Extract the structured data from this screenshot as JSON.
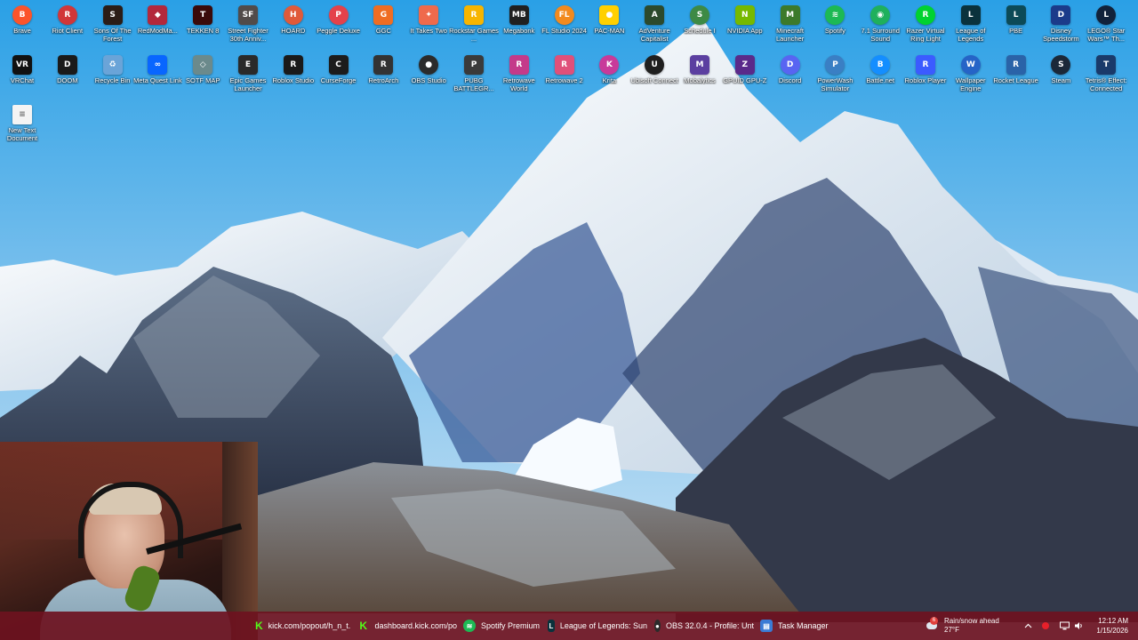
{
  "desktop": {
    "icons": [
      {
        "label": "Brave",
        "icon": "brave-icon",
        "color": "#fb542b",
        "glyph": "B",
        "round": true
      },
      {
        "label": "Riot Client",
        "icon": "riot-icon",
        "color": "#d13639",
        "glyph": "R",
        "round": true
      },
      {
        "label": "Sons Of The Forest",
        "icon": "sons-forest-icon",
        "color": "#2b1d17",
        "glyph": "S",
        "round": false
      },
      {
        "label": "RedModMa...",
        "icon": "redmod-icon",
        "color": "#b3283c",
        "glyph": "◆",
        "round": false
      },
      {
        "label": "TEKKEN 8",
        "icon": "tekken-icon",
        "color": "#3a0a0a",
        "glyph": "T",
        "round": false
      },
      {
        "label": "Street Fighter 30th Anniv...",
        "icon": "street-fighter-icon",
        "color": "#514b4a",
        "glyph": "SF",
        "round": false
      },
      {
        "label": "HOARD",
        "icon": "hoard-icon",
        "color": "#e05a3a",
        "glyph": "H",
        "round": true
      },
      {
        "label": "Peggle Deluxe",
        "icon": "peggle-icon",
        "color": "#e4424b",
        "glyph": "P",
        "round": true
      },
      {
        "label": "GGC",
        "icon": "ggc-icon",
        "color": "#ef6d23",
        "glyph": "G",
        "round": false
      },
      {
        "label": "It Takes Two",
        "icon": "it-takes-two-icon",
        "color": "#ef6a4c",
        "glyph": "✦",
        "round": false
      },
      {
        "label": "Rockstar Games ...",
        "icon": "rockstar-icon",
        "color": "#f7b500",
        "glyph": "R",
        "round": false
      },
      {
        "label": "Megabonk",
        "icon": "megabonk-icon",
        "color": "#202020",
        "glyph": "MB",
        "round": false
      },
      {
        "label": "FL Studio 2024",
        "icon": "fl-studio-icon",
        "color": "#f28a1e",
        "glyph": "FL",
        "round": true
      },
      {
        "label": "PAC-MAN",
        "icon": "pacman-icon",
        "color": "#ffd000",
        "glyph": "●",
        "round": false
      },
      {
        "label": "AdVenture Capitalist",
        "icon": "adventure-capitalist-icon",
        "color": "#2c4a2c",
        "glyph": "A",
        "round": false
      },
      {
        "label": "Schedule I",
        "icon": "schedule-icon",
        "color": "#3d8a45",
        "glyph": "S",
        "round": true
      },
      {
        "label": "NVIDIA App",
        "icon": "nvidia-icon",
        "color": "#76b900",
        "glyph": "N",
        "round": false
      },
      {
        "label": "Minecraft Launcher",
        "icon": "minecraft-icon",
        "color": "#3c7a2b",
        "glyph": "M",
        "round": false
      },
      {
        "label": "Spotify",
        "icon": "spotify-icon",
        "color": "#1db954",
        "glyph": "≋",
        "round": true
      },
      {
        "label": "7.1 Surround Sound",
        "icon": "surround-sound-icon",
        "color": "#1fb05c",
        "glyph": "◉",
        "round": true
      },
      {
        "label": "Razer Virtual Ring Light",
        "icon": "razer-icon",
        "color": "#00d230",
        "glyph": "R",
        "round": true
      },
      {
        "label": "League of Legends",
        "icon": "league-icon",
        "color": "#0a323c",
        "glyph": "L",
        "round": false
      },
      {
        "label": "PBE",
        "icon": "pbe-icon",
        "color": "#0c4a57",
        "glyph": "L",
        "round": false
      },
      {
        "label": "Disney Speedstorm",
        "icon": "disney-speedstorm-icon",
        "color": "#1b3b8a",
        "glyph": "D",
        "round": false
      },
      {
        "label": "LEGO® Star Wars™ Th...",
        "icon": "lego-star-wars-icon",
        "color": "#12223a",
        "glyph": "L",
        "round": true
      },
      {
        "label": "VRChat",
        "icon": "vrchat-icon",
        "color": "#111111",
        "glyph": "VR",
        "round": false
      },
      {
        "label": "DOOM",
        "icon": "doom-icon",
        "color": "#1a1a1a",
        "glyph": "D",
        "round": false
      },
      {
        "label": "Recycle Bin",
        "icon": "recycle-bin-icon",
        "color": "#6aa4d8",
        "glyph": "♻",
        "round": false
      },
      {
        "label": "Meta Quest Link",
        "icon": "meta-quest-icon",
        "color": "#0866ff",
        "glyph": "∞",
        "round": false
      },
      {
        "label": "SOTF MAP",
        "icon": "sotf-map-icon",
        "color": "#6b8a8c",
        "glyph": "◇",
        "round": false
      },
      {
        "label": "Epic Games Launcher",
        "icon": "epic-games-icon",
        "color": "#2a2a2a",
        "glyph": "E",
        "round": false
      },
      {
        "label": "Roblox Studio",
        "icon": "roblox-studio-icon",
        "color": "#1a1a1a",
        "glyph": "R",
        "round": false
      },
      {
        "label": "CurseForge",
        "icon": "curseforge-icon",
        "color": "#1c1c1c",
        "glyph": "C",
        "round": false
      },
      {
        "label": "RetroArch",
        "icon": "retroarch-icon",
        "color": "#333333",
        "glyph": "R",
        "round": false
      },
      {
        "label": "OBS Studio",
        "icon": "obs-icon",
        "color": "#2b2b2b",
        "glyph": "●",
        "round": true
      },
      {
        "label": "PUBG BATTLEGR...",
        "icon": "pubg-icon",
        "color": "#3a3a3a",
        "glyph": "P",
        "round": false
      },
      {
        "label": "Retrowave World",
        "icon": "retrowave-world-icon",
        "color": "#c43a8a",
        "glyph": "R",
        "round": false
      },
      {
        "label": "Retrowave 2",
        "icon": "retrowave-2-icon",
        "color": "#e0507a",
        "glyph": "R",
        "round": false
      },
      {
        "label": "Krita",
        "icon": "krita-icon",
        "color": "#c83a9a",
        "glyph": "K",
        "round": true
      },
      {
        "label": "Ubisoft Connect",
        "icon": "ubisoft-icon",
        "color": "#1f1f1f",
        "glyph": "U",
        "round": true
      },
      {
        "label": "Mobalytics",
        "icon": "mobalytics-icon",
        "color": "#5b3fa0",
        "glyph": "M",
        "round": false
      },
      {
        "label": "GPUID GPU-Z",
        "icon": "gpu-z-icon",
        "color": "#5a2a8a",
        "glyph": "Z",
        "round": false
      },
      {
        "label": "Discord",
        "icon": "discord-icon",
        "color": "#5865f2",
        "glyph": "D",
        "round": true
      },
      {
        "label": "PowerWash Simulator",
        "icon": "powerwash-icon",
        "color": "#3a7fc4",
        "glyph": "P",
        "round": true
      },
      {
        "label": "Battle.net",
        "icon": "battlenet-icon",
        "color": "#148eff",
        "glyph": "B",
        "round": true
      },
      {
        "label": "Roblox Player",
        "icon": "roblox-player-icon",
        "color": "#3b5bff",
        "glyph": "R",
        "round": false
      },
      {
        "label": "Wallpaper Engine",
        "icon": "wallpaper-engine-icon",
        "color": "#2564c7",
        "glyph": "W",
        "round": true
      },
      {
        "label": "Rocket League",
        "icon": "rocket-league-icon",
        "color": "#2a63a8",
        "glyph": "R",
        "round": false
      },
      {
        "label": "Steam",
        "icon": "steam-icon",
        "color": "#1b2838",
        "glyph": "S",
        "round": true
      },
      {
        "label": "Tetris® Effect: Connected",
        "icon": "tetris-effect-icon",
        "color": "#1a3a6a",
        "glyph": "T",
        "round": false
      },
      {
        "label": "New Text Document",
        "icon": "text-document-icon",
        "color": "#f4f4f4",
        "glyph": "≡",
        "round": false
      }
    ]
  },
  "taskbar": {
    "tasks": [
      {
        "label": "kick.com/popout/h_n_t...",
        "icon": "kick-icon",
        "color": "#53fc18",
        "glyph": "K",
        "round": false
      },
      {
        "label": "dashboard.kick.com/po",
        "icon": "kick-icon",
        "color": "#53fc18",
        "glyph": "K",
        "round": false
      },
      {
        "label": "Spotify Premium",
        "icon": "spotify-icon",
        "color": "#1db954",
        "glyph": "≋",
        "round": true
      },
      {
        "label": "League of Legends: Sun",
        "icon": "league-icon",
        "color": "#0a323c",
        "glyph": "L",
        "round": false
      },
      {
        "label": "OBS 32.0.4 - Profile: Unt",
        "icon": "obs-icon",
        "color": "#2b2b2b",
        "glyph": "●",
        "round": true
      },
      {
        "label": "Task Manager",
        "icon": "task-manager-icon",
        "color": "#3a7bd5",
        "glyph": "▤",
        "round": false
      }
    ],
    "weather": {
      "text": "Rain/snow ahead",
      "temp": "27°F",
      "badge": "6"
    },
    "clock": {
      "time": "12:12 AM",
      "date": "1/15/2026"
    }
  },
  "colors": {
    "taskbar": "#6e1220",
    "sky": "#8fc3e6"
  }
}
